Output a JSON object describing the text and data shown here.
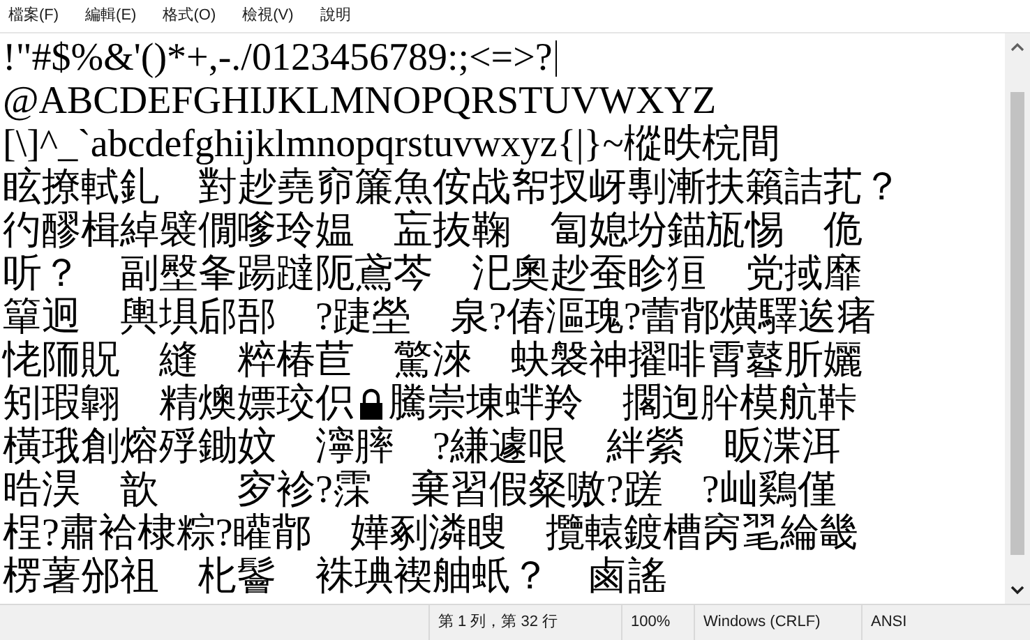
{
  "menu": [
    "檔案(F)",
    "編輯(E)",
    "格式(O)",
    "檢視(V)",
    "說明"
  ],
  "editor": {
    "lines": [
      {
        "text": "!\"#$%&'()*+,-./0123456789:;<=>?",
        "caret": true
      },
      {
        "text": "@ABCDEFGHIJKLMNOPQRSTUVWXYZ"
      },
      {
        "text": "[\\]^_`abcdefghijklmnopqrstuvwxyz{|}~樅昳梡間"
      },
      {
        "text": "眩撩軾釓　對赻堯窌簾魚侒战帤扠岈剸漸扶籟詰芤？"
      },
      {
        "text": "彴醪楫綽襞僩嗲玲媪　衁抜鞠　匐媳坋錨瓬惕　佹"
      },
      {
        "text": "听？　副壂夆踼躂阨鳶芩　汜奧赻蚕眕狟　党掝靡"
      },
      {
        "text": "簞迥　輿埧郈郚　?踕塋　泉?偆漚瑰?蕾鄁熿驛逘瘏"
      },
      {
        "text": "恅陑貺　縫　粹椿苣　驚淶　蚗褩神擢啡霄鼛肵孋"
      },
      {
        "text": "矧瑕翺　精燠嫖珓伿",
        "lock": true,
        "after": "騰崇埬蝆羚　擱迿肸模航鞐"
      },
      {
        "text": "橫珴創熔殍鋤妏　濘膟　?縑遽哏　絆縈　昄渫洱"
      },
      {
        "text": "晧淏　歆　　穸袗?霂　棄習假粲嗷?蹉　?屾鷄僅"
      },
      {
        "text": "桯?肅袷棣粽?矔鄁　嬅剢潾瞍　攬轅鍍槽窉毣綸畿"
      },
      {
        "text": "楞薯邠祖　朼鬠　袾琠褉舳蚔？　鹵謠"
      }
    ]
  },
  "status_bar": [
    "第 1 列，第 32 行",
    "100%",
    "Windows (CRLF)",
    "ANSI"
  ]
}
